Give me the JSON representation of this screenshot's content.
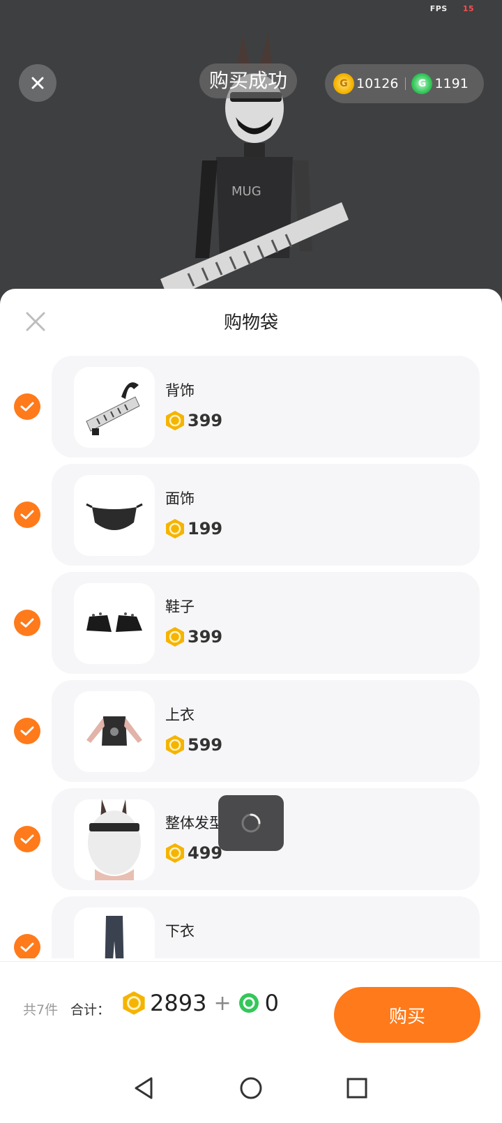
{
  "status_bar": {
    "fps_label": "FPS",
    "fps_value": "15"
  },
  "header": {
    "success_text": "购买成功",
    "gold_balance": "10126",
    "green_balance": "1191"
  },
  "sheet": {
    "title": "购物袋"
  },
  "items": [
    {
      "name": "背饰",
      "price": "399",
      "checked": true,
      "thumb_icon": "keytar-icon"
    },
    {
      "name": "面饰",
      "price": "199",
      "checked": true,
      "thumb_icon": "mask-icon"
    },
    {
      "name": "鞋子",
      "price": "399",
      "checked": true,
      "thumb_icon": "shoes-icon"
    },
    {
      "name": "上衣",
      "price": "599",
      "checked": true,
      "thumb_icon": "top-icon"
    },
    {
      "name": "整体发型",
      "price": "499",
      "checked": true,
      "thumb_icon": "hair-icon"
    },
    {
      "name": "下衣",
      "price": "",
      "checked": true,
      "thumb_icon": "pants-icon"
    }
  ],
  "footer": {
    "count_text": "共7件",
    "total_label": "合计：",
    "gold_total": "2893",
    "plus": "+",
    "green_total": "0",
    "buy_label": "购买"
  },
  "colors": {
    "accent": "#ff7a1a",
    "gold": "#f5b400",
    "green": "#34c759"
  }
}
